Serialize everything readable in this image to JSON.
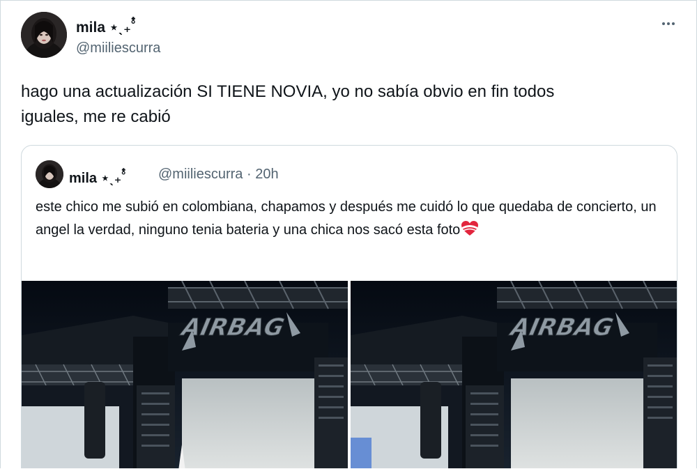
{
  "tweet": {
    "author": {
      "name": "mila ⋆ˎ₊˚๋",
      "handle": "@miiliescurra"
    },
    "text": "hago una actualización SI TIENE NOVIA, yo no sabía obvio en fin todos\niguales, me re cabió"
  },
  "quoted_tweet": {
    "author": {
      "name": "mila ⋆ˎ₊˚๋",
      "handle": "@miiliescurra · 20h"
    },
    "text": "este chico me subió en colombiana, chapamos y después me cuidó lo que quedaba de concierto, un angel la verdad, ninguno tenia bateria y una chica nos sacó esta foto",
    "emoji": "heart-with-ribbon-icon",
    "media": [
      {
        "logo_text": "AIRBAG"
      },
      {
        "logo_text": "AIRBAG"
      }
    ]
  },
  "colors": {
    "text_primary": "#0f1419",
    "text_secondary": "#536471",
    "border": "#cfd9de"
  }
}
